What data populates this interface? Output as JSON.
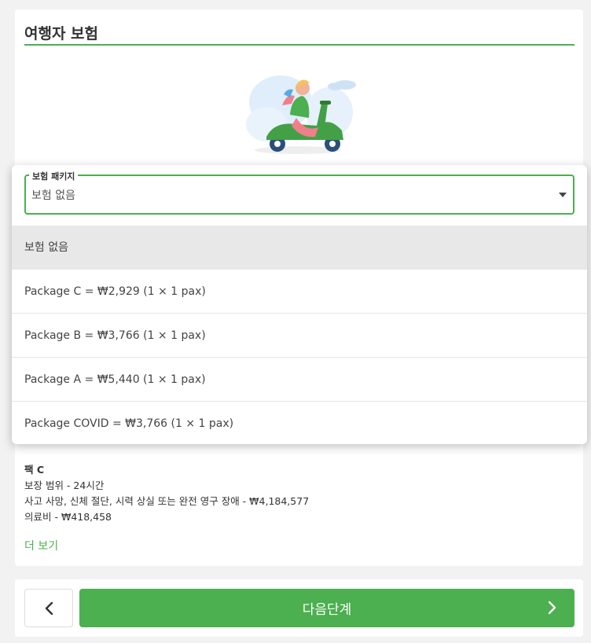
{
  "section": {
    "title": "여행자 보험"
  },
  "select": {
    "legend": "보험 패키지",
    "value": "보험 없음"
  },
  "options": [
    "보험 없음",
    "Package C = ₩2,929 (1 × 1 pax)",
    "Package B = ₩3,766 (1 × 1 pax)",
    "Package A = ₩5,440 (1 × 1 pax)",
    "Package COVID = ₩3,766 (1 × 1 pax)"
  ],
  "package_details": {
    "name": "팩 C",
    "lines": [
      "보장 범위 - 24시간",
      "사고 사망, 신체 절단, 시력 상실 또는 완전 영구 장애 - ₩4,184,577",
      "의료비 - ₩418,458"
    ],
    "more_label": "더 보기"
  },
  "nav": {
    "next_label": "다음단계"
  },
  "colors": {
    "accent": "#4caf50"
  }
}
